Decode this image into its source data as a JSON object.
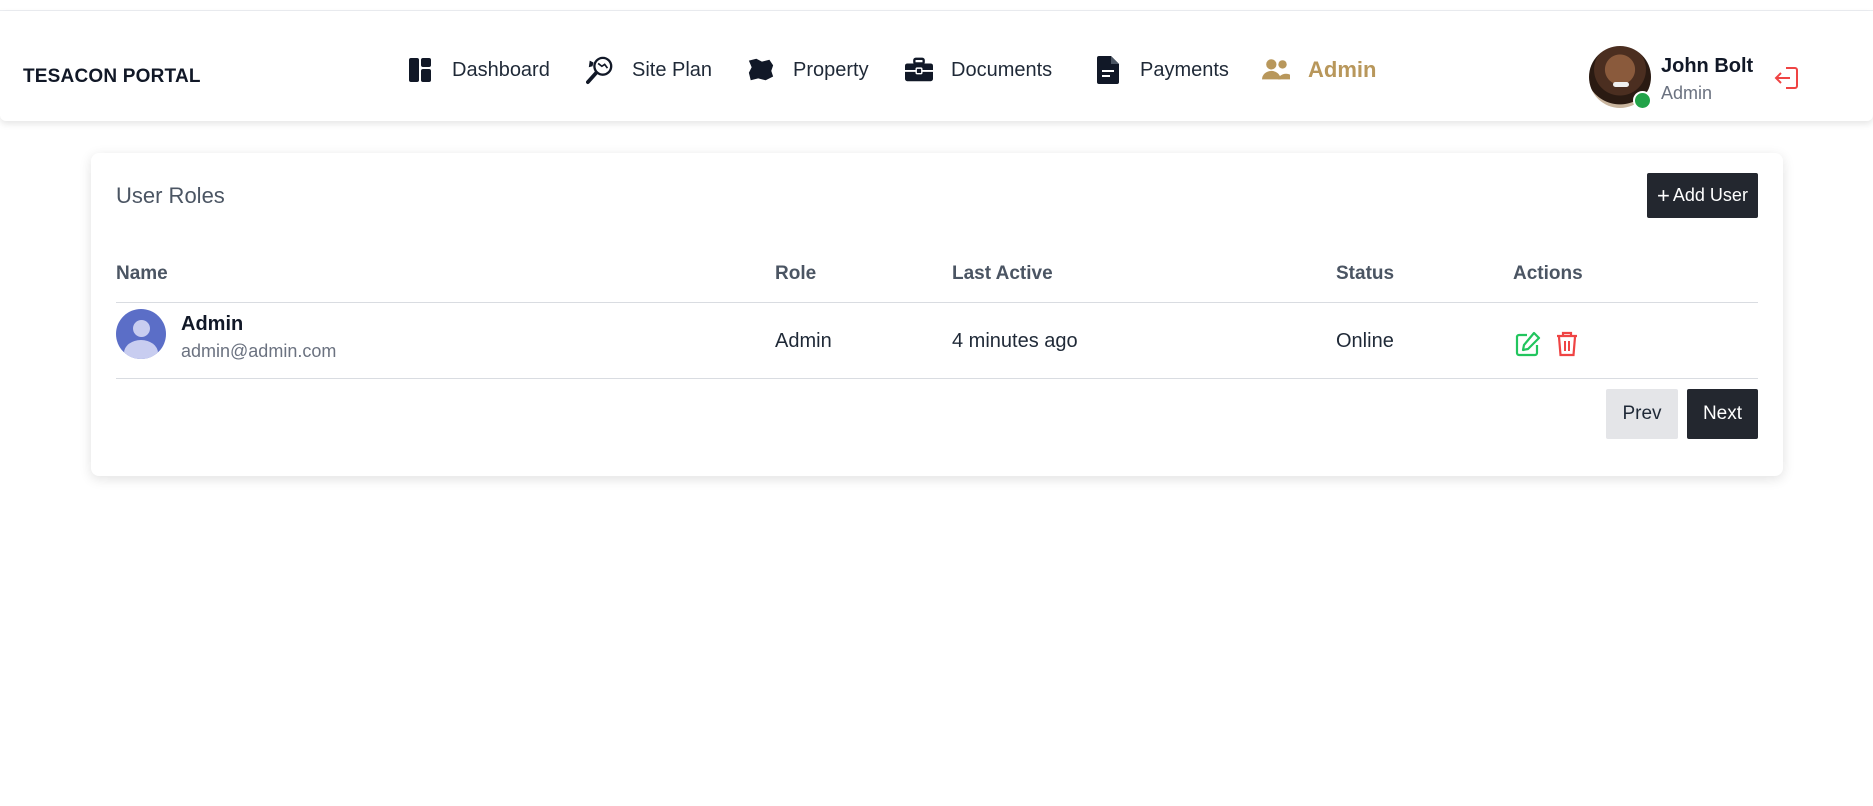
{
  "brand": "TESACON PORTAL",
  "nav": {
    "items": [
      {
        "label": "Dashboard",
        "icon": "dashboard-icon"
      },
      {
        "label": "Site Plan",
        "icon": "map-search-icon"
      },
      {
        "label": "Property",
        "icon": "land-plot-icon"
      },
      {
        "label": "Documents",
        "icon": "briefcase-icon"
      },
      {
        "label": "Payments",
        "icon": "document-icon"
      },
      {
        "label": "Admin",
        "icon": "users-icon",
        "active": true
      }
    ]
  },
  "user": {
    "name": "John Bolt",
    "role": "Admin",
    "status": "online"
  },
  "card": {
    "title": "User Roles",
    "add_button": "Add User",
    "columns": [
      "Name",
      "Role",
      "Last Active",
      "Status",
      "Actions"
    ],
    "rows": [
      {
        "name": "Admin",
        "email": "admin@admin.com",
        "role": "Admin",
        "last_active": "4 minutes ago",
        "status": "Online"
      }
    ],
    "pagination": {
      "prev": "Prev",
      "next": "Next"
    }
  },
  "colors": {
    "accent": "#b8975b",
    "dark_button": "#23272f",
    "edit": "#22c55e",
    "delete": "#ef4444",
    "online": "#22a349"
  }
}
